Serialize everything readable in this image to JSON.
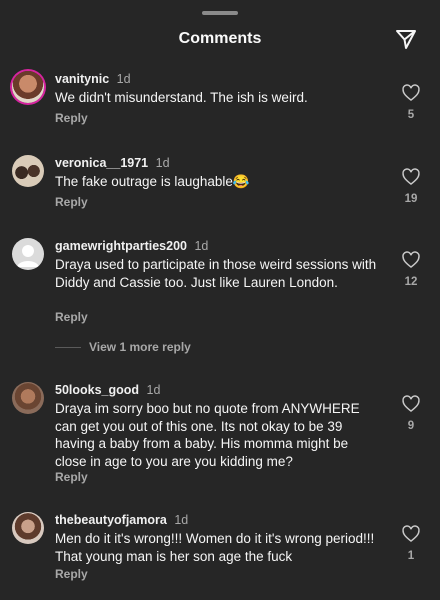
{
  "header": {
    "title": "Comments"
  },
  "comments": [
    {
      "username": "vanitynic",
      "time": "1d",
      "text": "We didn't misunderstand. The ish is weird.",
      "reply": "Reply",
      "likes": "5"
    },
    {
      "username": "veronica__1971",
      "time": "1d",
      "text": "The fake outrage is laughable😂",
      "reply": "Reply",
      "likes": "19"
    },
    {
      "username": "gamewrightparties200",
      "time": "1d",
      "text": "Draya used to participate in those weird sessions with Diddy and Cassie too. Just like Lauren London.",
      "reply": "Reply",
      "likes": "12",
      "view_more": "View 1 more reply"
    },
    {
      "username": "50looks_good",
      "time": "1d",
      "text": "Draya im sorry boo but no quote from ANYWHERE can get you out of this one. Its not okay to be 39 having a baby from a baby. His momma might be close in age to you are you kidding me?",
      "reply": "Reply",
      "likes": "9"
    },
    {
      "username": "thebeautyofjamora",
      "time": "1d",
      "text": "Men do it it's wrong!!! Women do it it's wrong period!!! That young man is her son age the fuck",
      "reply": "Reply",
      "likes": "1"
    }
  ],
  "icons": {
    "share": "send-icon",
    "like": "heart-icon"
  }
}
